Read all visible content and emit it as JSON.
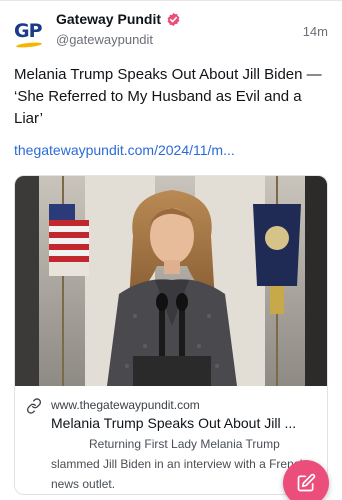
{
  "post": {
    "author_name": "Gateway Pundit",
    "author_handle": "@gatewaypundit",
    "avatar_text": "GP",
    "timestamp": "14m",
    "text": "Melania Trump Speaks Out About Jill Biden — ‘She Referred to My Husband as Evil and a Liar’",
    "link_text": "thegatewaypundit.com/2024/11/m..."
  },
  "card": {
    "domain": "www.thegatewaypundit.com",
    "title": "Melania Trump Speaks Out About Jill ...",
    "description": "Returning First Lady Melania Trump slammed Jill Biden in an interview with a French news outlet."
  },
  "colors": {
    "link": "#2a6bd8",
    "verified": "#ec4e7c",
    "fab": "#ec4e7c"
  },
  "icons": {
    "verified": "verified-badge-icon",
    "link": "link-icon",
    "compose": "compose-icon"
  }
}
